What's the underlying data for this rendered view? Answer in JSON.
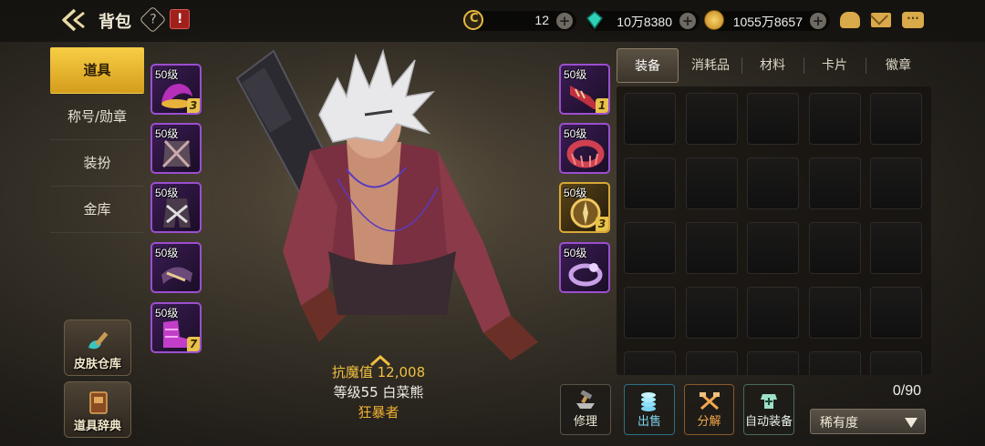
{
  "header": {
    "title": "背包",
    "help_icon": "help-diamond-icon",
    "calendar_icon": "event-calendar-icon"
  },
  "currencies": [
    {
      "name": "c-coin",
      "value": "12",
      "icon": "c-coin-icon",
      "color": "#e6b940"
    },
    {
      "name": "gem",
      "value": "10万8380",
      "icon": "teal-gem-icon",
      "color": "#2fd2b6"
    },
    {
      "name": "gold",
      "value": "1055万8657",
      "icon": "gold-coin-icon",
      "color": "#e0a93a"
    }
  ],
  "top_icons": [
    "treasure-bag-icon",
    "mail-icon",
    "chat-icon"
  ],
  "nav": {
    "items": [
      {
        "label": "道具",
        "active": true
      },
      {
        "label": "称号/勋章",
        "active": false
      },
      {
        "label": "装扮",
        "active": false
      },
      {
        "label": "金库",
        "active": false
      }
    ]
  },
  "side_buttons": [
    {
      "label": "皮肤仓库"
    },
    {
      "label": "道具辞典"
    }
  ],
  "left_equipment": [
    {
      "level": "50级",
      "count": "3",
      "rarity": "epic"
    },
    {
      "level": "50级",
      "count": "",
      "rarity": "epic"
    },
    {
      "level": "50级",
      "count": "",
      "rarity": "epic"
    },
    {
      "level": "50级",
      "count": "",
      "rarity": "epic"
    },
    {
      "level": "50级",
      "count": "7",
      "rarity": "epic"
    }
  ],
  "right_equipment": [
    {
      "level": "50级",
      "count": "1",
      "rarity": "epic"
    },
    {
      "level": "50级",
      "count": "",
      "rarity": "epic"
    },
    {
      "level": "50级",
      "count": "3",
      "rarity": "legendary"
    },
    {
      "level": "50级",
      "count": "",
      "rarity": "epic"
    }
  ],
  "character": {
    "resist": "抗魔值 12,008",
    "level_name": "等级55 白菜熊",
    "class": "狂暴者"
  },
  "tabs": [
    {
      "label": "装备",
      "active": true
    },
    {
      "label": "消耗品",
      "active": false
    },
    {
      "label": "材料",
      "active": false
    },
    {
      "label": "卡片",
      "active": false
    },
    {
      "label": "徽章",
      "active": false
    }
  ],
  "inventory": {
    "count": "0/90",
    "columns": 5,
    "visible_rows": 5
  },
  "actions": {
    "repair": "修理",
    "sell": "出售",
    "disassemble": "分解",
    "auto_equip": "自动装备"
  },
  "rarity_select": {
    "selected": "稀有度"
  }
}
